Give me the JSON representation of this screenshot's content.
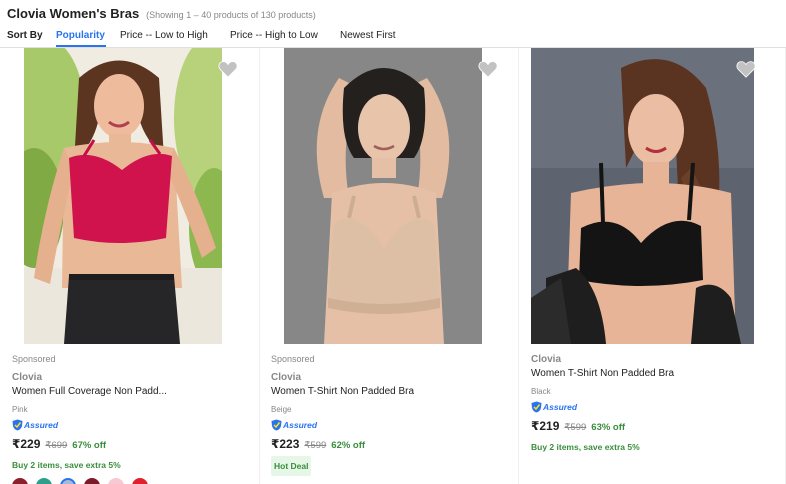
{
  "header": {
    "title": "Clovia Women's Bras",
    "count": "(Showing 1 – 40 products of 130 products)"
  },
  "sort": {
    "label": "Sort By",
    "options": [
      "Popularity",
      "Price -- Low to High",
      "Price -- High to Low",
      "Newest First"
    ],
    "active": "Popularity"
  },
  "products": [
    {
      "sponsored": "Sponsored",
      "brand": "Clovia",
      "name": "Women Full Coverage Non Padd...",
      "color": "Pink",
      "assured": "Assured",
      "price": "₹229",
      "mrp": "₹699",
      "discount": "67% off",
      "offer": "Buy 2 items, save extra 5%",
      "swatch_colors": [
        "#8b1f2b",
        "#2f9e8a",
        "#a9b9d6",
        "#7a1b2a",
        "#f6c9d3",
        "#e0202f"
      ],
      "image_colors": {
        "bg": "#f1ece2",
        "top": "#d0124d",
        "jeans": "#262629",
        "skin": "#e9b897",
        "hair": "#5c3521",
        "foliage": "#8cb84f"
      }
    },
    {
      "sponsored": "Sponsored",
      "brand": "Clovia",
      "name": "Women T-Shirt Non Padded Bra",
      "color": "Beige",
      "assured": "Assured",
      "price": "₹223",
      "mrp": "₹599",
      "discount": "62% off",
      "badge": "Hot Deal",
      "image_colors": {
        "bg": "#8c8c8b",
        "bra": "#dcbfa4",
        "skin": "#e5c0a7",
        "hair": "#24201d"
      }
    },
    {
      "brand": "Clovia",
      "name": "Women T-Shirt Non Padded Bra",
      "color": "Black",
      "assured": "Assured",
      "price": "₹219",
      "mrp": "₹599",
      "discount": "63% off",
      "offer": "Buy 2 items, save extra 5%",
      "image_colors": {
        "bg": "#5d6470",
        "bra": "#141414",
        "skin": "#e8b497",
        "hair": "#5a3321"
      }
    }
  ],
  "icons": {
    "heart": "heart-icon",
    "assured": "assured-shield-icon"
  },
  "colors": {
    "accent": "#2874f0",
    "green": "#388e3c",
    "muted": "#878787"
  }
}
